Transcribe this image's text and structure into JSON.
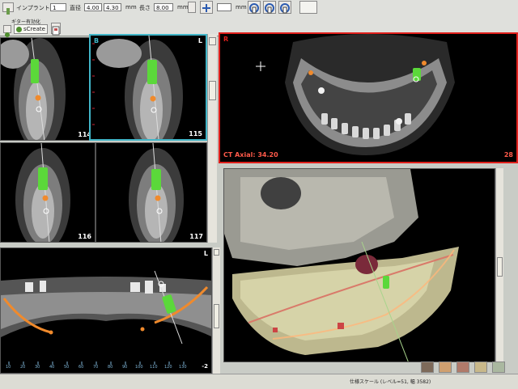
{
  "toolbar": {
    "implant_label": "インプラント",
    "implant_value": "1",
    "diameter_label": "直径",
    "diameter_value_1": "4.00",
    "diameter_value_2": "4.30",
    "unit_mm": "mm",
    "length_label": "長さ",
    "length_value": "8.00",
    "stepper_value": "",
    "secondary_label": "ギター有効化",
    "create_label": "sCreate"
  },
  "panes": {
    "cross_1": {
      "number": "114"
    },
    "cross_2": {
      "tag": "B",
      "side": "L",
      "number": "115"
    },
    "cross_3": {
      "number": "116"
    },
    "cross_4": {
      "number": "117"
    },
    "panoramic": {
      "side": "L",
      "scale_value": "-2",
      "ruler_ticks": [
        "10",
        "20",
        "30",
        "40",
        "50",
        "60",
        "70",
        "80",
        "90",
        "100",
        "110",
        "120",
        "130"
      ]
    },
    "axial": {
      "tag": "R",
      "caption": "CT Axial: 34.20",
      "corner_number": "28"
    }
  },
  "status_bar": {
    "text": "仕様スケール (レベル=51, 幅 3582)"
  },
  "colors": {
    "accent_red": "#e0201c",
    "implant_green": "#5bd83a",
    "nerve_orange": "#f08a2c",
    "bone": "#d6d3a8"
  }
}
